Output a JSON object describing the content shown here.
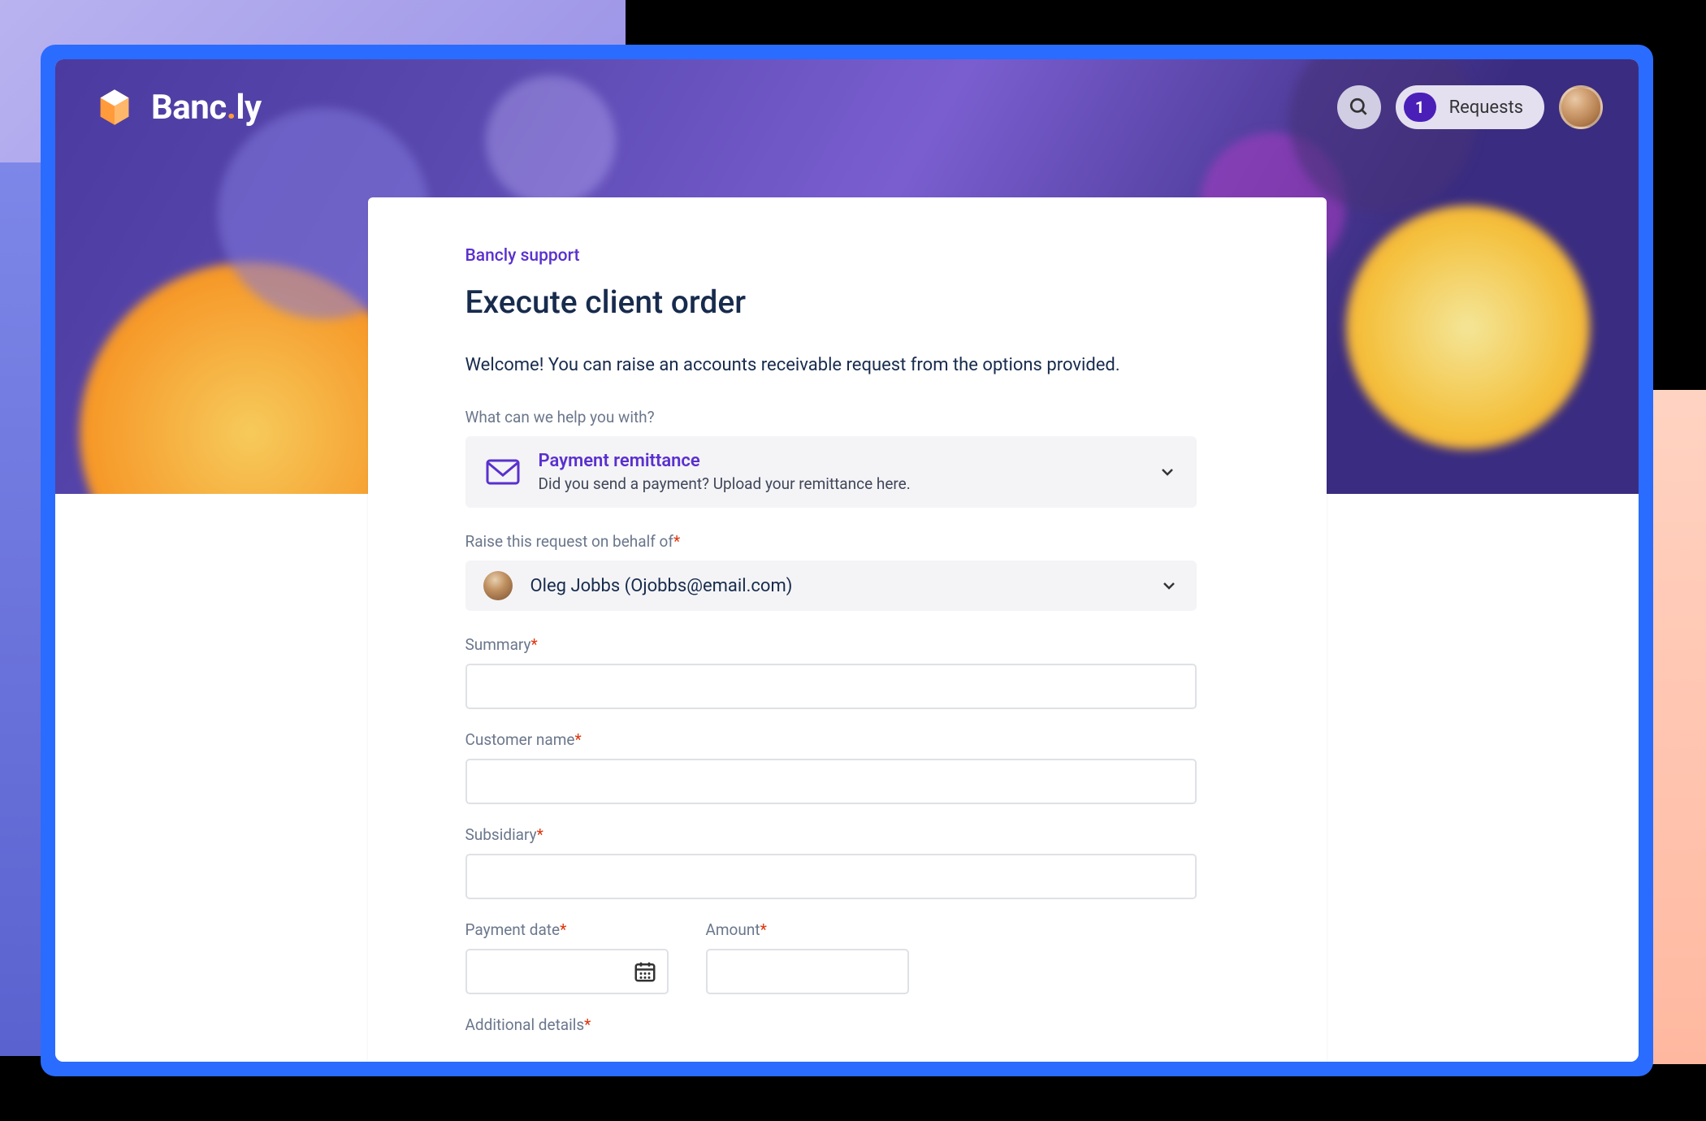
{
  "brand": {
    "name_a": "Banc",
    "name_b": "ly"
  },
  "header": {
    "requests_badge": "1",
    "requests_label": "Requests"
  },
  "breadcrumb": "Bancly support",
  "page_title": "Execute client order",
  "intro_text": "Welcome! You can raise an accounts receivable request from the options provided.",
  "help_label": "What can we help you with?",
  "request_type": {
    "title": "Payment remittance",
    "subtitle": "Did you send a payment? Upload your remittance here."
  },
  "behalf": {
    "label": "Raise this request on behalf of",
    "user": "Oleg Jobbs (Ojobbs@email.com)"
  },
  "fields": {
    "summary": "Summary",
    "customer": "Customer name",
    "subsidiary": "Subsidiary",
    "payment_date": "Payment date",
    "amount": "Amount",
    "additional": "Additional details"
  },
  "required_marker": "*"
}
